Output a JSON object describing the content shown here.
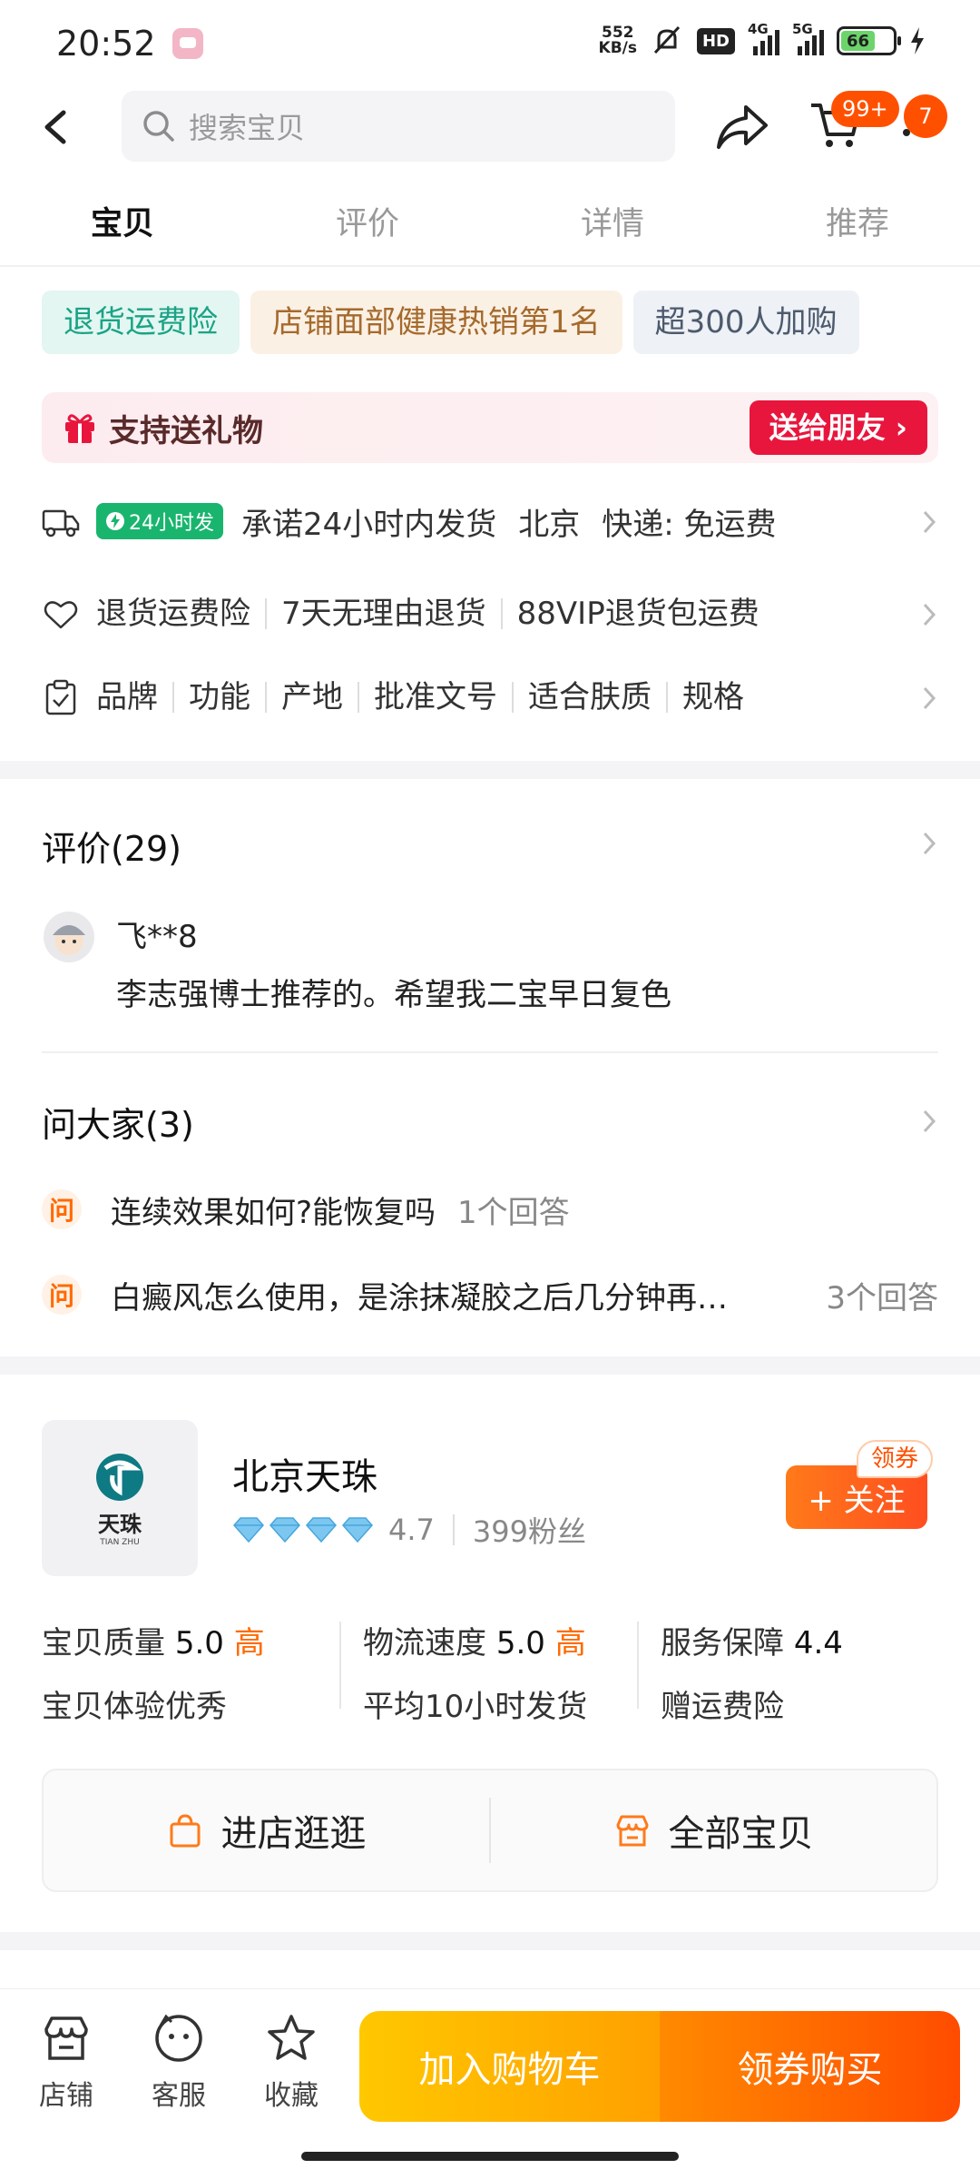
{
  "status_bar": {
    "time": "20:52",
    "net_speed_value": "552",
    "net_speed_unit": "KB/s",
    "hd_label": "HD",
    "sig1_label": "4G",
    "sig2_label": "5G",
    "battery": "66"
  },
  "header": {
    "search_placeholder": "搜索宝贝",
    "cart_badge": "99+",
    "message_badge": "7"
  },
  "tabs": [
    {
      "label": "宝贝",
      "active": true
    },
    {
      "label": "评价",
      "active": false
    },
    {
      "label": "详情",
      "active": false
    },
    {
      "label": "推荐",
      "active": false
    }
  ],
  "chips": [
    "退货运费险",
    "店铺面部健康热销第1名",
    "超300人加购"
  ],
  "gift": {
    "label": "支持送礼物",
    "button": "送给朋友 ›"
  },
  "shipping": {
    "badge": "24小时发",
    "promise": "承诺24小时内发货",
    "city": "北京",
    "express": "快递: 免运费"
  },
  "service": [
    "退货运费险",
    "7天无理由退货",
    "88VIP退货包运费"
  ],
  "params": [
    "品牌",
    "功能",
    "产地",
    "批准文号",
    "适合肤质",
    "规格"
  ],
  "reviews": {
    "title": "评价(29)",
    "user": "飞**8",
    "text": "李志强博士推荐的。希望我二宝早日复色"
  },
  "qa": {
    "title": "问大家(3)",
    "q_icon": "问",
    "items": [
      {
        "q": "连续效果如何?能恢复吗",
        "count": "1个回答"
      },
      {
        "q": "白癜风怎么使用，是涂抹凝胶之后几分钟再…",
        "count": "3个回答"
      }
    ]
  },
  "shop": {
    "logo_text": "天珠",
    "logo_sub": "TIAN  ZHU",
    "name": "北京天珠",
    "diamonds": 4,
    "rating": "4.7",
    "fans": "399粉丝",
    "follow": "+ 关注",
    "coupon": "领券",
    "scores": [
      {
        "label": "宝贝质量",
        "value": "5.0",
        "level": "高",
        "desc": "宝贝体验优秀"
      },
      {
        "label": "物流速度",
        "value": "5.0",
        "level": "高",
        "desc": "平均10小时发货"
      },
      {
        "label": "服务保障",
        "value": "4.4",
        "level": "",
        "desc": "赠运费险"
      }
    ],
    "enter_store": "进店逛逛",
    "all_items": "全部宝贝"
  },
  "bottom_bar": {
    "store": "店铺",
    "service": "客服",
    "favorite": "收藏",
    "add_cart": "加入购物车",
    "buy": "领券购买"
  },
  "colors": {
    "accent": "#ff5000",
    "teal": "#1aa386",
    "gift_red": "#e8163d",
    "green_pill": "#19b56e"
  }
}
